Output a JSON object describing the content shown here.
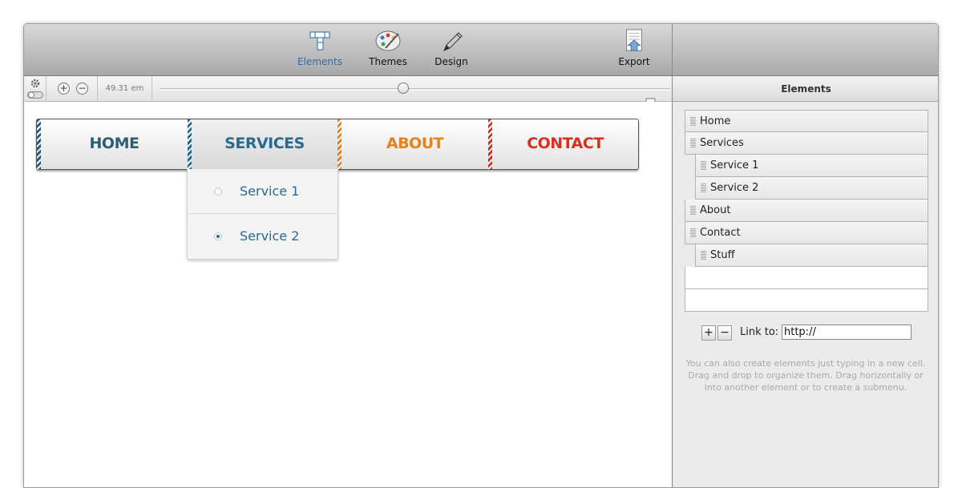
{
  "toolbar": {
    "elements_label": "Elements",
    "themes_label": "Themes",
    "design_label": "Design",
    "export_label": "Export"
  },
  "zoombar": {
    "zoom_in_label": "+",
    "zoom_out_label": "−",
    "em_value": "49.31 em"
  },
  "menu": {
    "items": [
      {
        "label": "HOME",
        "color": "#2c5f73"
      },
      {
        "label": "SERVICES",
        "color": "#2a6a8f"
      },
      {
        "label": "ABOUT",
        "color": "#e6821e"
      },
      {
        "label": "CONTACT",
        "color": "#d8301c"
      }
    ],
    "dropdown": [
      {
        "label": "Service 1",
        "selected": false
      },
      {
        "label": "Service 2",
        "selected": true
      }
    ]
  },
  "sidebar": {
    "title": "Elements",
    "items": [
      {
        "label": "Home"
      },
      {
        "label": "Services"
      },
      {
        "label": "Service 1"
      },
      {
        "label": "Service 2"
      },
      {
        "label": "About"
      },
      {
        "label": "Contact"
      },
      {
        "label": "Stuff"
      }
    ],
    "add_label": "+",
    "remove_label": "−",
    "link_label": "Link to:",
    "link_value": "http://",
    "help_text": "You can also create elements just typing in a new cell. Drag and drop to organize them. Drag horizontally or into another element or to create a submenu."
  },
  "colors": {
    "accent": "#2b6aa8",
    "stripe_teal": "#2a6a8f",
    "stripe_orange": "#e6821e",
    "stripe_red": "#d8301c"
  }
}
